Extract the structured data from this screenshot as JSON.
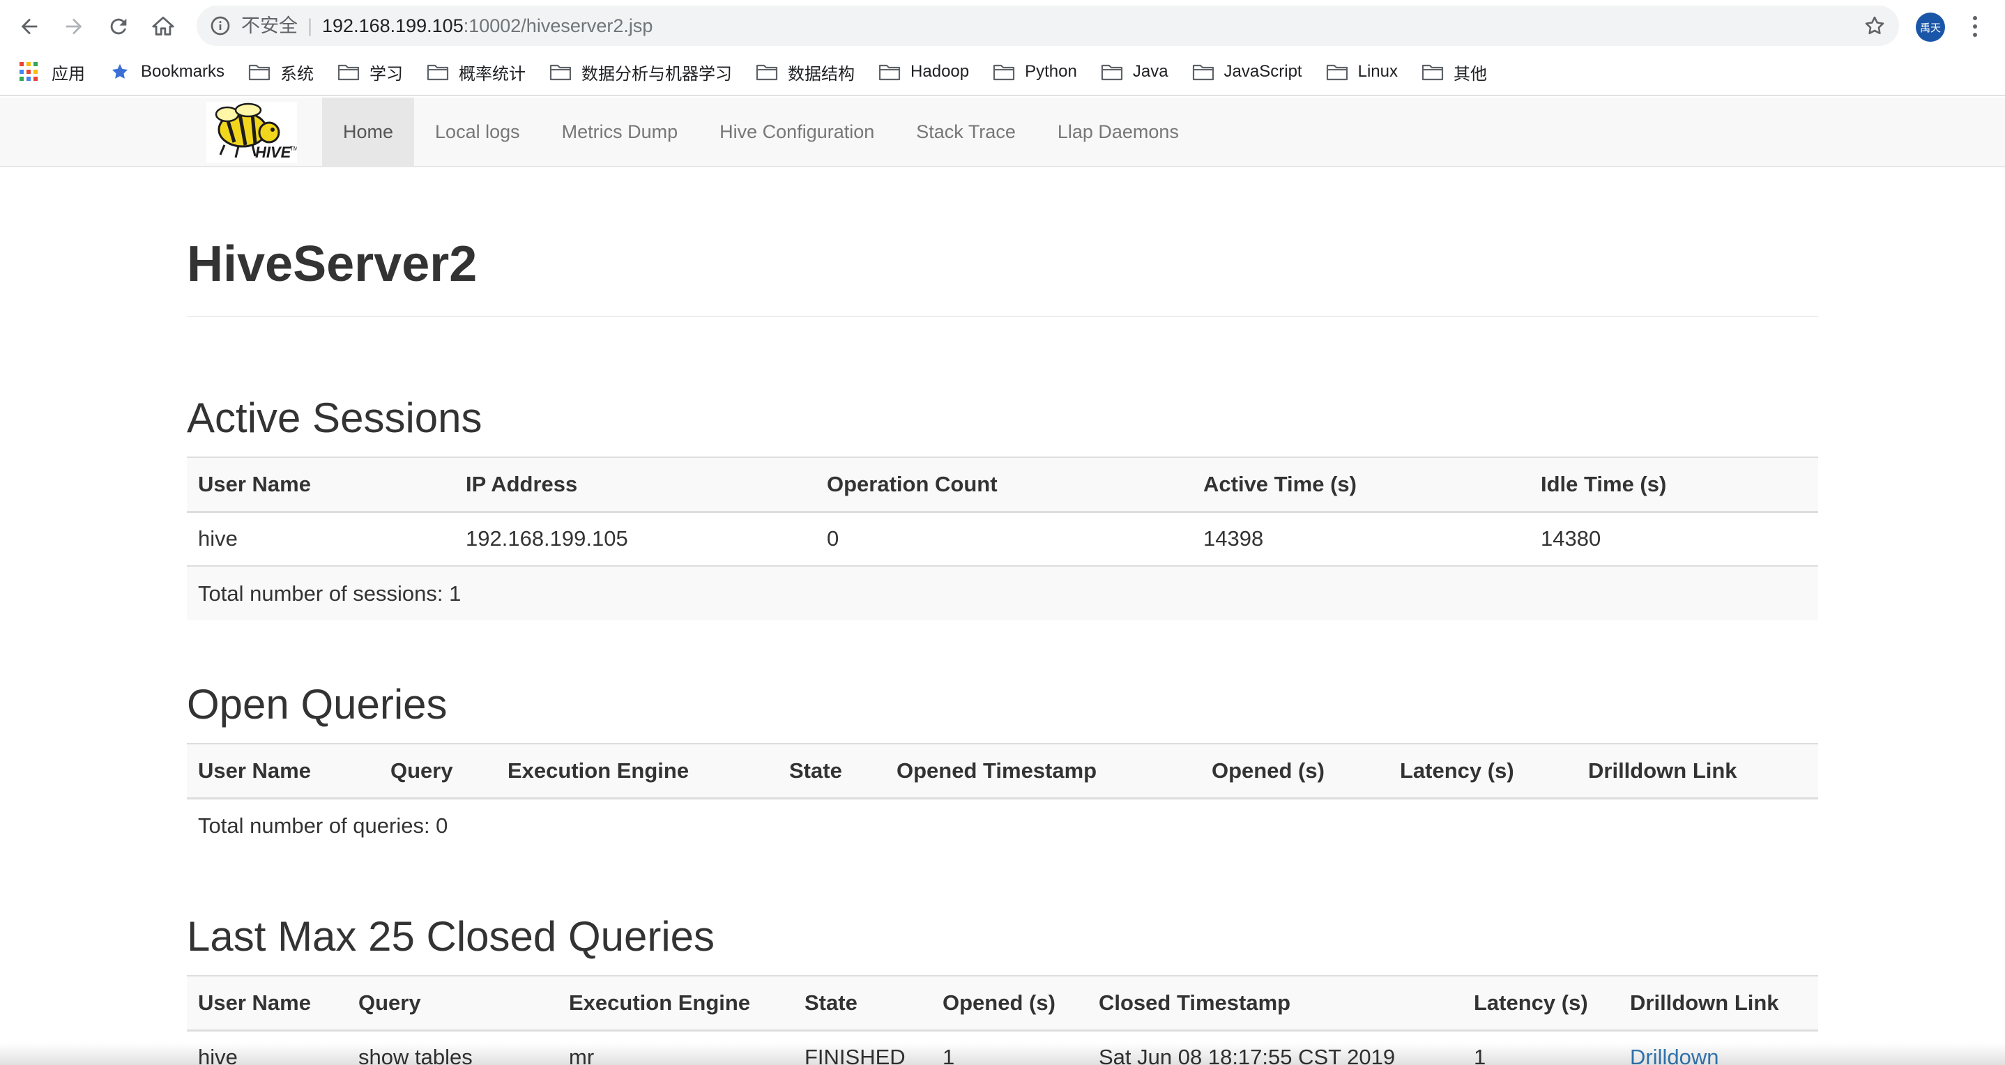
{
  "browser": {
    "omnibox": {
      "security_label": "不安全",
      "separator": "|",
      "host": "192.168.199.105",
      "path": ":10002/hiveserver2.jsp"
    },
    "avatar_text": "禹天",
    "bookmarks": [
      {
        "label": "应用",
        "icon": "apps-grid-icon"
      },
      {
        "label": "Bookmarks",
        "icon": "star-icon"
      },
      {
        "label": "系统",
        "icon": "folder-icon"
      },
      {
        "label": "学习",
        "icon": "folder-icon"
      },
      {
        "label": "概率统计",
        "icon": "folder-icon"
      },
      {
        "label": "数据分析与机器学习",
        "icon": "folder-icon"
      },
      {
        "label": "数据结构",
        "icon": "folder-icon"
      },
      {
        "label": "Hadoop",
        "icon": "folder-icon"
      },
      {
        "label": "Python",
        "icon": "folder-icon"
      },
      {
        "label": "Java",
        "icon": "folder-icon"
      },
      {
        "label": "JavaScript",
        "icon": "folder-icon"
      },
      {
        "label": "Linux",
        "icon": "folder-icon"
      },
      {
        "label": "其他",
        "icon": "folder-icon"
      }
    ]
  },
  "navbar": {
    "items": [
      {
        "label": "Home",
        "active": true
      },
      {
        "label": "Local logs"
      },
      {
        "label": "Metrics Dump"
      },
      {
        "label": "Hive Configuration"
      },
      {
        "label": "Stack Trace"
      },
      {
        "label": "Llap Daemons"
      }
    ]
  },
  "page": {
    "title": "HiveServer2"
  },
  "active_sessions": {
    "heading": "Active Sessions",
    "columns": [
      "User Name",
      "IP Address",
      "Operation Count",
      "Active Time (s)",
      "Idle Time (s)"
    ],
    "rows": [
      [
        "hive",
        "192.168.199.105",
        "0",
        "14398",
        "14380"
      ]
    ],
    "total": "Total number of sessions: 1"
  },
  "open_queries": {
    "heading": "Open Queries",
    "columns": [
      "User Name",
      "Query",
      "Execution Engine",
      "State",
      "Opened Timestamp",
      "Opened (s)",
      "Latency (s)",
      "Drilldown Link"
    ],
    "total": "Total number of queries: 0"
  },
  "closed_queries": {
    "heading": "Last Max 25 Closed Queries",
    "columns": [
      "User Name",
      "Query",
      "Execution Engine",
      "State",
      "Opened (s)",
      "Closed Timestamp",
      "Latency (s)",
      "Drilldown Link"
    ],
    "rows": [
      [
        "hive",
        "show tables",
        "mr",
        "FINISHED",
        "1",
        "Sat Jun 08 18:17:55 CST 2019",
        "1",
        "Drilldown"
      ]
    ]
  },
  "colors": {
    "link": "#337ab7",
    "avatar_bg": "#1a56a8"
  }
}
